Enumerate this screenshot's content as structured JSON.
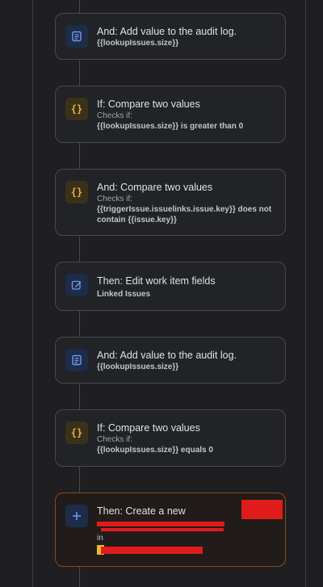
{
  "flow": {
    "cards": [
      {
        "icon": "audit-log-icon",
        "title": "And: Add value to the audit log.",
        "detail": "{{lookupIssues.size}}"
      },
      {
        "icon": "condition-braces-icon",
        "title": "If: Compare two values",
        "sub": "Checks if:",
        "detail": "{{lookupIssues.size}} is greater than 0"
      },
      {
        "icon": "condition-braces-icon",
        "title": "And: Compare two values",
        "sub": "Checks if:",
        "detail": "{{triggerIssue.issuelinks.issue.key}} does not contain {{issue.key}}"
      },
      {
        "icon": "edit-icon",
        "title": "Then: Edit work item fields",
        "detail": "Linked Issues"
      },
      {
        "icon": "audit-log-icon",
        "title": "And: Add value to the audit log.",
        "detail": "{{lookupIssues.size}}"
      },
      {
        "icon": "condition-braces-icon",
        "title": "If: Compare two values",
        "sub": "Checks if:",
        "detail": "{{lookupIssues.size}} equals 0"
      },
      {
        "icon": "plus-icon",
        "title": "Then: Create a new",
        "detail": "in"
      }
    ],
    "brace_glyph": "{}"
  },
  "colors": {
    "background": "#1f1f21",
    "card_border": "#47494f",
    "highlight_border": "#8a4a1d",
    "blue_icon": "#6f9bef",
    "yellow_icon": "#e3b341",
    "redaction": "#e01b1b"
  }
}
